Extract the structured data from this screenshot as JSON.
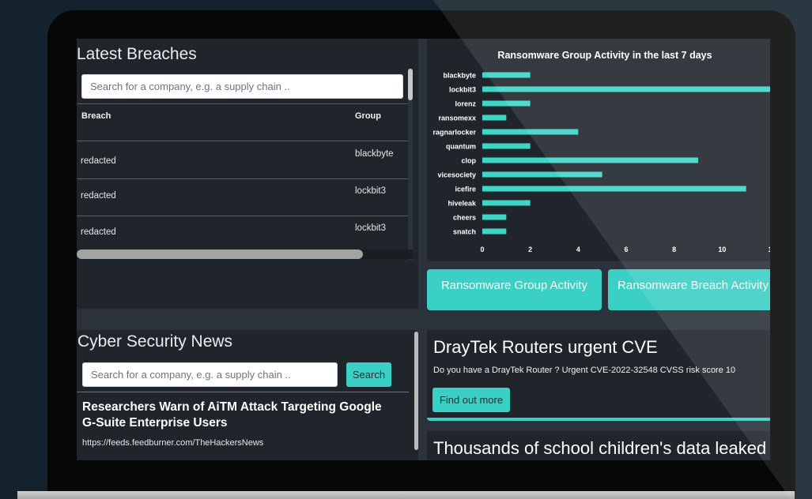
{
  "breaches": {
    "title": "Latest Breaches",
    "search_placeholder": "Search for a company, e.g. a supply chain ..",
    "columns": [
      "Breach",
      "Group"
    ],
    "rows": [
      {
        "breach": "redacted",
        "group": "blackbyte"
      },
      {
        "breach": "redacted",
        "group": "lockbit3"
      },
      {
        "breach": "redacted",
        "group": "lockbit3"
      }
    ]
  },
  "chart_data": {
    "type": "bar",
    "orientation": "horizontal",
    "title": "Ransomware Group Activity in the last 7 days",
    "categories": [
      "blackbyte",
      "lockbit3",
      "lorenz",
      "ransomexx",
      "ragnarlocker",
      "quantum",
      "clop",
      "vicesociety",
      "icefire",
      "hiveleak",
      "cheers",
      "snatch"
    ],
    "values": [
      2,
      12,
      2,
      1,
      4,
      2,
      9,
      5,
      11,
      2,
      1,
      1
    ],
    "xlim": [
      0,
      12
    ],
    "xticks": [
      "0",
      "2",
      "4",
      "6",
      "8",
      "10",
      "1"
    ],
    "bar_color": "#3dd6c9"
  },
  "tabs": {
    "group_activity": "Ransomware Group Activity",
    "breach_activity": "Ransomware Breach Activity"
  },
  "news": {
    "title": "Cyber Security News",
    "search_placeholder": "Search for a company, e.g. a supply chain ..",
    "search_button": "Search",
    "items": [
      {
        "headline": "Researchers Warn of AiTM Attack Targeting Google G-Suite Enterprise Users",
        "source": "https://feeds.feedburner.com/TheHackersNews"
      }
    ]
  },
  "alerts": [
    {
      "title": "DrayTek Routers urgent CVE",
      "text": "Do you have a DrayTek Router ? Urgent CVE-2022-32548 CVSS risk score 10",
      "button": "Find out more"
    },
    {
      "title": "Thousands of school children's data leaked"
    }
  ],
  "colors": {
    "accent": "#3ad0c5",
    "panel": "#20252c",
    "background": "#13222c"
  }
}
